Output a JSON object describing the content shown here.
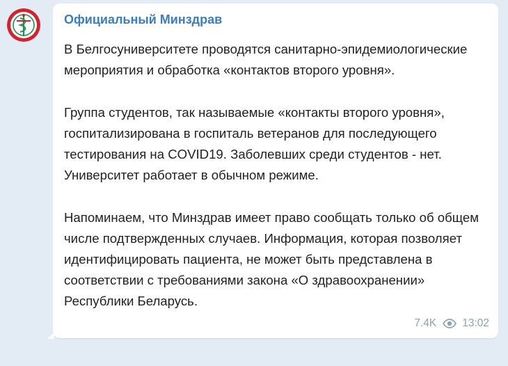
{
  "channel": {
    "name": "Официальный Минздрав",
    "avatar_icon": "medical-emblem-icon",
    "avatar_color": "#d4232d"
  },
  "message": {
    "paragraphs": [
      "В Белгосуниверситете проводятся санитарно-эпидемиологические мероприятия и обработка «контактов второго уровня».",
      "Группа студентов, так называемые «контакты второго уровня», госпитализирована в госпиталь ветеранов для последующего тестирования на COVID19. Заболевших среди студентов - нет. Университет работает в обычном режиме.",
      "Напоминаем, что Минздрав имеет право сообщать только об общем числе подтвержденных случаев. Информация, которая позволяет идентифицировать пациента, не может быть представлена в соответствии с требованиями закона «О здравоохранении» Республики Беларусь."
    ],
    "views": "7.4K",
    "views_icon": "eye-icon",
    "time": "13:02"
  },
  "colors": {
    "background": "#e3ecf4",
    "channel_name": "#3b7ec0",
    "meta_text": "#8fa0ae"
  }
}
